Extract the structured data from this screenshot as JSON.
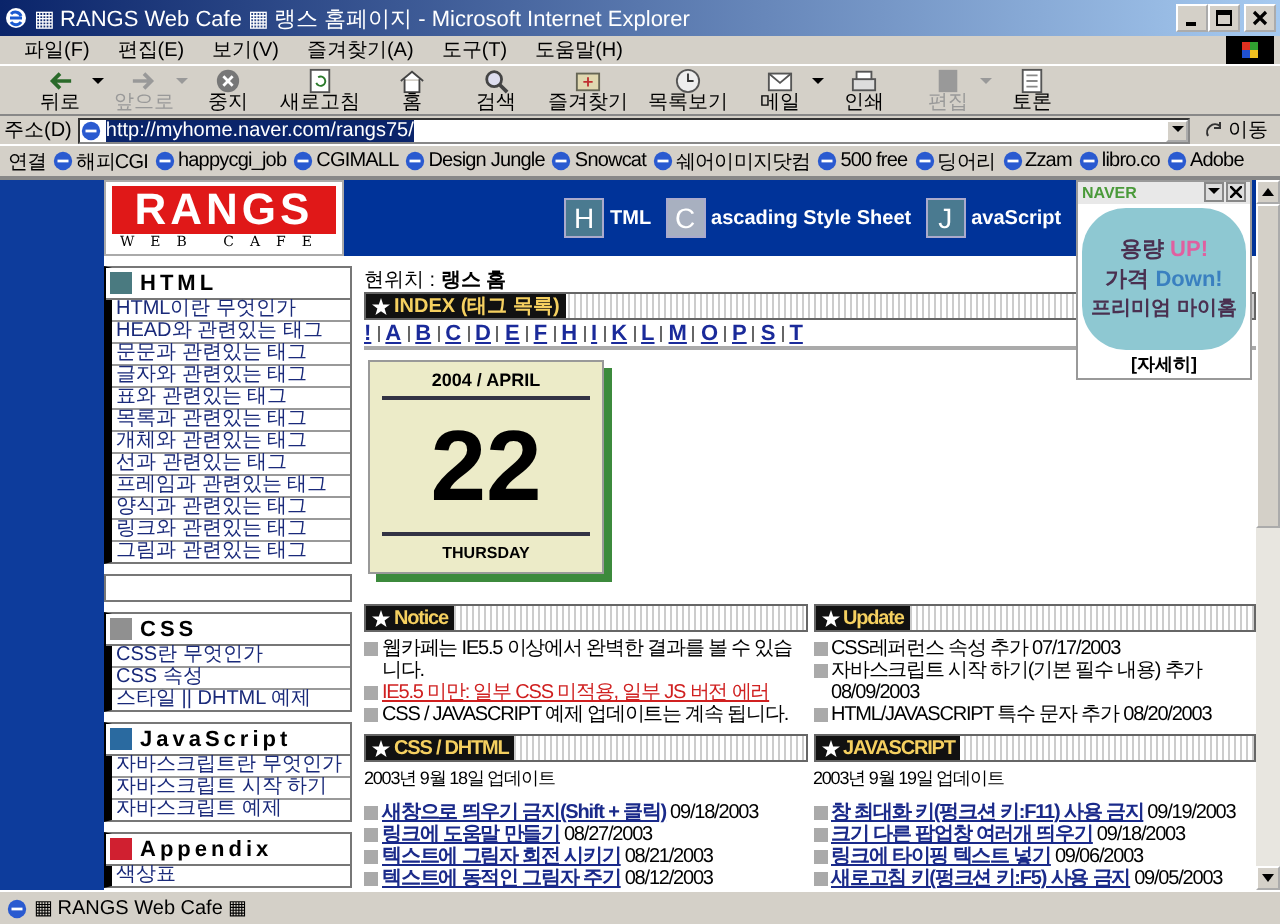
{
  "window": {
    "title": "▦ RANGS Web Cafe ▦ 랭스 홈페이지 - Microsoft Internet Explorer"
  },
  "menu": [
    "파일(F)",
    "편집(E)",
    "보기(V)",
    "즐겨찾기(A)",
    "도구(T)",
    "도움말(H)"
  ],
  "toolbar": [
    {
      "kind": "back",
      "label": "뒤로",
      "disabled": false,
      "dropdown": true
    },
    {
      "kind": "forward",
      "label": "앞으로",
      "disabled": true,
      "dropdown": true
    },
    {
      "kind": "stop",
      "label": "중지",
      "disabled": false,
      "dropdown": false
    },
    {
      "kind": "refresh",
      "label": "새로고침",
      "disabled": false,
      "dropdown": false
    },
    {
      "kind": "home",
      "label": "홈",
      "disabled": false,
      "dropdown": false
    },
    {
      "kind": "search",
      "label": "검색",
      "disabled": false,
      "dropdown": false
    },
    {
      "kind": "favorites",
      "label": "즐겨찾기",
      "disabled": false,
      "dropdown": false
    },
    {
      "kind": "history",
      "label": "목록보기",
      "disabled": false,
      "dropdown": false
    },
    {
      "kind": "mail",
      "label": "메일",
      "disabled": false,
      "dropdown": true
    },
    {
      "kind": "print",
      "label": "인쇄",
      "disabled": false,
      "dropdown": false
    },
    {
      "kind": "edit",
      "label": "편집",
      "disabled": true,
      "dropdown": true
    },
    {
      "kind": "discuss",
      "label": "토론",
      "disabled": false,
      "dropdown": false
    }
  ],
  "address": {
    "label": "주소(D)",
    "value": "http://myhome.naver.com/rangs75/",
    "go": "이동"
  },
  "links": {
    "label": "연결",
    "items": [
      "해피CGI",
      "happycgi_job",
      "CGIMALL",
      "Design Jungle",
      "Snowcat",
      "쉐어이미지닷컴",
      "500 free",
      "딩어리",
      "Zzam",
      "libro.co",
      "Adobe"
    ]
  },
  "page": {
    "logo": {
      "title": "RANGS",
      "subtitle": "WEB CAFE"
    },
    "nav": [
      {
        "letter": "H",
        "text": "TML",
        "selected": false
      },
      {
        "letter": "C",
        "text": "ascading Style Sheet",
        "selected": true
      },
      {
        "letter": "J",
        "text": "avaScript",
        "selected": false
      }
    ],
    "sidebar": [
      {
        "title": "HTML",
        "color": "#4a7a80",
        "items": [
          "HTML이란 무엇인가",
          "HEAD와 관련있는 태그",
          "문문과 관련있는 태그",
          "글자와 관련있는 태그",
          "표와 관련있는 태그",
          "목록과 관련있는 태그",
          "개체와 관련있는 태그",
          "선과 관련있는 태그",
          "프레임과 관련있는 태그",
          "양식과 관련있는 태그",
          "링크와 관련있는 태그",
          "그림과 관련있는 태그"
        ]
      },
      {
        "title": "CSS",
        "color": "#909090",
        "items": [
          "CSS란 무엇인가",
          "CSS 속성",
          "스타일 || DHTML 예제"
        ]
      },
      {
        "title": "JavaScript",
        "color": "#2a6aa0",
        "items": [
          "자바스크립트란 무엇인가",
          "자바스크립트 시작 하기",
          "자바스크립트 예제"
        ]
      },
      {
        "title": "Appendix",
        "color": "#d02030",
        "items": [
          "색상표"
        ]
      }
    ],
    "breadcrumb": {
      "label": "현위치 :",
      "value": "랭스 홈"
    },
    "index": {
      "title": "INDEX (태그 목록)",
      "letters": [
        "!",
        "A",
        "B",
        "C",
        "D",
        "E",
        "F",
        "H",
        "I",
        "K",
        "L",
        "M",
        "O",
        "P",
        "S",
        "T"
      ]
    },
    "calendar": {
      "month": "2004 / APRIL",
      "day": "22",
      "weekday": "THURSDAY"
    },
    "boards": [
      {
        "title": "Notice",
        "items": [
          {
            "kind": "text",
            "text": "웹카페는 IE5.5 이상에서 완벽한 결과를 볼 수 있습니다."
          },
          {
            "kind": "alert",
            "text": "IE5.5 미만: 일부 CSS 미적용, 일부 JS 버전 에러"
          },
          {
            "kind": "text",
            "text": "CSS / JAVASCRIPT 예제 업데이트는 계속 됩니다."
          }
        ]
      },
      {
        "title": "Update",
        "items": [
          {
            "kind": "text",
            "text": "CSS레퍼런스 속성 추가 07/17/2003"
          },
          {
            "kind": "text",
            "text": "자바스크립트 시작 하기(기본 필수 내용) 추가 08/09/2003"
          },
          {
            "kind": "text",
            "text": "HTML/JAVASCRIPT 특수 문자 추가 08/20/2003"
          }
        ]
      },
      {
        "title": "CSS / DHTML",
        "date": "2003년 9월 18일 업데이트",
        "items": [
          {
            "kind": "link",
            "text": "새창으로 띄우기 금지(Shift + 클릭)",
            "date": "09/18/2003"
          },
          {
            "kind": "link",
            "text": "링크에 도움말 만들기",
            "date": "08/27/2003"
          },
          {
            "kind": "link",
            "text": "텍스트에 그림자 회전 시키기",
            "date": "08/21/2003"
          },
          {
            "kind": "link",
            "text": "텍스트에 동적인 그림자 주기",
            "date": "08/12/2003"
          }
        ]
      },
      {
        "title": "JAVASCRIPT",
        "date": "2003년 9월 19일 업데이트",
        "items": [
          {
            "kind": "link",
            "text": "창 최대화 키(펑크션 키:F11) 사용 금지",
            "date": "09/19/2003"
          },
          {
            "kind": "link",
            "text": "크기 다른 팝업창 여러개 띄우기",
            "date": "09/18/2003"
          },
          {
            "kind": "link",
            "text": "링크에 타이핑 텍스트 넣기",
            "date": "09/06/2003"
          },
          {
            "kind": "link",
            "text": "새로고침 키(펑크션 키:F5) 사용 금지",
            "date": "09/05/2003"
          }
        ]
      }
    ]
  },
  "ad": {
    "brand": "NAVER",
    "line_1": "용량",
    "highlight_1": "UP!",
    "line_2": "가격",
    "highlight_2": "Down!",
    "line_3": "프리미엄 마이홈",
    "link": "[자세히]"
  },
  "status_bar": {
    "text": "▦ RANGS Web Cafe ▦"
  }
}
